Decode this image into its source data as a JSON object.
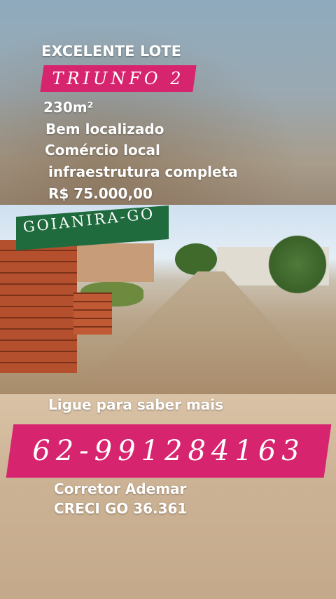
{
  "header": {
    "headline": "EXCELENTE LOTE",
    "neighborhood": "TRIUNFO 2"
  },
  "details": {
    "area": "230m²",
    "line1": "Bem localizado",
    "line2": "Comércio local",
    "line3": "infraestrutura  completa",
    "price": "R$ 75.000,00"
  },
  "photo": {
    "city_label": "GOIANIRA-GO"
  },
  "contact": {
    "call_to_action": "Ligue para saber mais",
    "phone": "62-991284163",
    "agent_name": "Corretor Ademar",
    "license": "CRECI GO 36.361"
  },
  "colors": {
    "pink_banner": "#d7246e",
    "green_banner": "#1f6b3e"
  }
}
